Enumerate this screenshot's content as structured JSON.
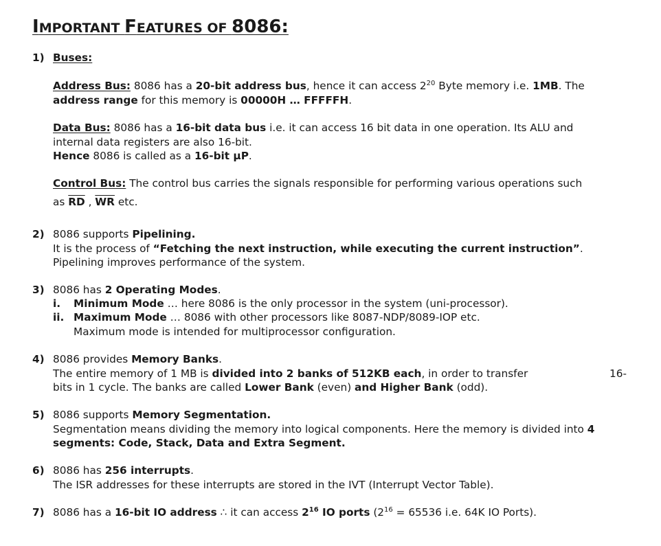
{
  "title": {
    "first": "I",
    "rest1": "MPORTANT ",
    "second": "F",
    "rest2": "EATURES OF ",
    "chip": "8086:"
  },
  "s1": {
    "num": "1)",
    "heading": "Buses:",
    "addr": {
      "label": "Address Bus:",
      "t1": " 8086 has a ",
      "b1": "20-bit address bus",
      "t2": ", hence it can access 2",
      "sup": "20",
      "t3": " Byte memory i.e. ",
      "b2": "1MB",
      "t4": ". The",
      "b3": "address range",
      "t5": " for this memory is ",
      "b4": "00000H … FFFFFH",
      "t6": "."
    },
    "data": {
      "label": "Data Bus:",
      "t1": " 8086 has a ",
      "b1": "16-bit data bus",
      "t2": " i.e. it can access 16 bit data in one operation. Its ALU and",
      "line2": "internal data registers are also 16-bit.",
      "b2": "Hence",
      "t3": " 8086 is called as a ",
      "b3": "16-bit µP",
      "t4": "."
    },
    "control": {
      "label": "Control Bus:",
      "t1": " The control bus carries the signals responsible for performing various operations such",
      "t2": "as ",
      "rd": "RD",
      "sep": " , ",
      "wr": "WR",
      "t3": "  etc."
    }
  },
  "s2": {
    "num": "2)",
    "t1": "8086 supports ",
    "b1": "Pipelining.",
    "t2": "It is the process of ",
    "b2": "“Fetching the next instruction, while executing the current instruction”",
    "t3": ".",
    "t4": "Pipelining improves performance of the system."
  },
  "s3": {
    "num": "3)",
    "t1": "8086 has ",
    "b1": "2 Operating Modes",
    "t2": ".",
    "i_num": "i.",
    "i_b": "Minimum Mode",
    "i_t": " … here 8086 is the only processor in the system (uni-processor).",
    "ii_num": "ii.",
    "ii_b": "Maximum Mode",
    "ii_t": " … 8086 with other processors like 8087-NDP/8089-IOP etc.",
    "ii_t2": "Maximum mode is intended for multiprocessor configuration."
  },
  "s4": {
    "num": "4)",
    "t1": "8086 provides ",
    "b1": "Memory Banks",
    "t2": ".",
    "t3": "The entire memory of 1 MB is ",
    "b2": "divided into 2 banks of 512KB each",
    "t4": ", in order to transfer",
    "t4b": "16-",
    "t5": "bits in 1 cycle. The banks are called ",
    "b3": "Lower Bank",
    "t6": " (even) ",
    "b4": "and Higher Bank",
    "t7": " (odd)."
  },
  "s5": {
    "num": "5)",
    "t1": "8086 supports ",
    "b1": "Memory Segmentation.",
    "t2": "Segmentation means dividing the memory into logical components. Here the memory is divided into ",
    "b2": "4",
    "b3": "segments: Code, Stack, Data and Extra Segment."
  },
  "s6": {
    "num": "6)",
    "t1": "8086 has ",
    "b1": "256 interrupts",
    "t2": ".",
    "t3": "The ISR addresses for these interrupts are stored in the IVT (Interrupt Vector Table)."
  },
  "s7": {
    "num": "7)",
    "t1": "8086 has a ",
    "b1": "16-bit IO address",
    "t2": " ∴ it can access ",
    "b2": "2",
    "sup1": "16",
    "b3": " IO ports",
    "t3": " (2",
    "sup2": "16",
    "t4": " = 65536 i.e. 64K IO Ports)."
  }
}
